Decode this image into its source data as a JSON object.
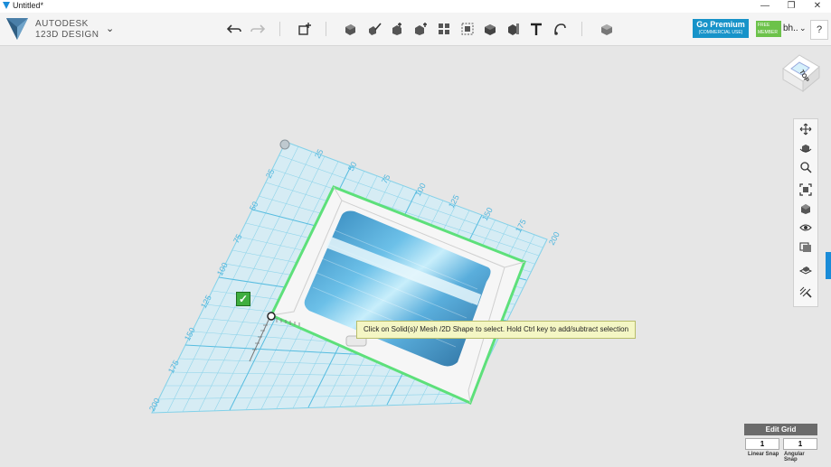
{
  "window": {
    "title": "Untitled*",
    "minimize": "—",
    "restore": "❐",
    "close": "✕"
  },
  "brand": {
    "line1": "AUTODESK",
    "line2": "123D DESIGN"
  },
  "toolbar": {
    "tools": [
      {
        "name": "undo-button",
        "icon": "undo-icon"
      },
      {
        "name": "redo-button",
        "icon": "redo-icon"
      },
      {
        "name": "transform-button",
        "icon": "transform-icon"
      },
      {
        "name": "primitives-button",
        "icon": "primitives-icon"
      },
      {
        "name": "sketch-button",
        "icon": "sketch-icon"
      },
      {
        "name": "construct-button",
        "icon": "construct-icon"
      },
      {
        "name": "modify-button",
        "icon": "modify-icon"
      },
      {
        "name": "pattern-button",
        "icon": "pattern-icon"
      },
      {
        "name": "group-button",
        "icon": "group-icon"
      },
      {
        "name": "combine-button",
        "icon": "combine-icon"
      },
      {
        "name": "measure-button",
        "icon": "measure-icon"
      },
      {
        "name": "text-button",
        "icon": "text-icon"
      },
      {
        "name": "snap-button",
        "icon": "snap-icon"
      },
      {
        "name": "material-button",
        "icon": "material-icon"
      }
    ]
  },
  "account": {
    "premium_title": "Go Premium",
    "premium_sub": "(COMMERCIAL USE)",
    "free_badge_line1": "FREE",
    "free_badge_line2": "MEMBER",
    "user_name": "bh..",
    "help": "?"
  },
  "viewcube": {
    "face_label": "TOP"
  },
  "grid": {
    "top_ticks": [
      "25",
      "50",
      "75",
      "100",
      "125",
      "150",
      "175",
      "200"
    ],
    "left_ticks": [
      "25",
      "50",
      "75",
      "100",
      "125",
      "150",
      "175",
      "200"
    ]
  },
  "tooltip": {
    "text": "Click on Solid(s)/ Mesh /2D Shape to select. Hold Ctrl key to add/subtract selection"
  },
  "grid_panel": {
    "edit_grid_label": "Edit Grid",
    "linear_snap_value": "1",
    "linear_snap_label": "Linear Snap",
    "angular_snap_value": "1",
    "angular_snap_label": "Angular Snap"
  },
  "colors": {
    "accent": "#1a8cd8",
    "premium": "#1793c9",
    "free": "#6cc24a",
    "grid": "#7fd0e8",
    "selection": "#5de07a"
  }
}
